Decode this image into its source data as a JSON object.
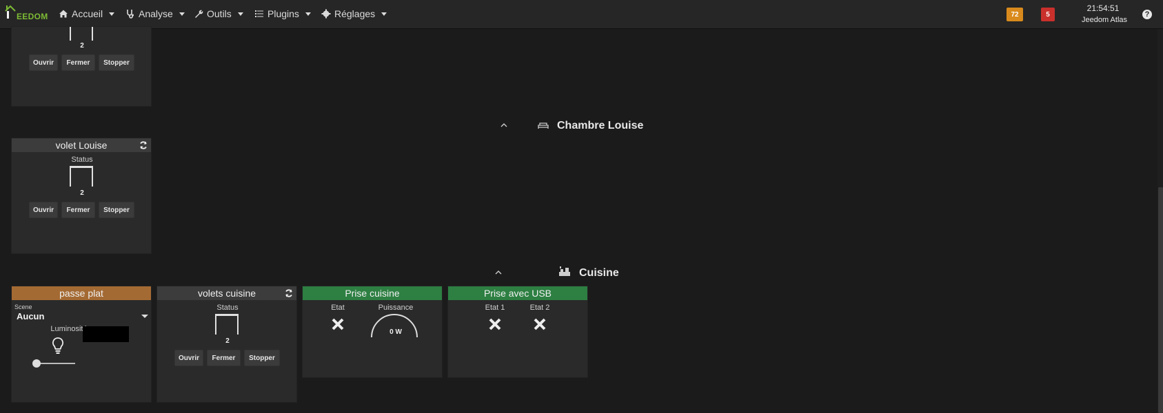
{
  "navbar": {
    "logo_text": "EEDOM",
    "menu": [
      {
        "label": "Accueil",
        "icon": "home-icon"
      },
      {
        "label": "Analyse",
        "icon": "stethoscope-icon"
      },
      {
        "label": "Outils",
        "icon": "wrench-icon"
      },
      {
        "label": "Plugins",
        "icon": "list-icon"
      },
      {
        "label": "Réglages",
        "icon": "gear-icon"
      }
    ],
    "badge_warning": "72",
    "badge_danger": "5",
    "clock": "21:54:51",
    "station": "Jeedom Atlas",
    "help": "?"
  },
  "widgets": {
    "top": {
      "value": "2",
      "buttons": [
        "Ouvrir",
        "Fermer",
        "Stopper"
      ]
    },
    "volet_louise": {
      "title": "volet Louise",
      "status_label": "Status",
      "value": "2",
      "buttons": [
        "Ouvrir",
        "Fermer",
        "Stopper"
      ]
    },
    "passe_plat": {
      "title": "passe plat",
      "scene_label": "Scene",
      "scene_value": "Aucun",
      "luminosite_label": "Luminosité"
    },
    "volets_cuisine": {
      "title": "volets cuisine",
      "status_label": "Status",
      "value": "2",
      "buttons": [
        "Ouvrir",
        "Fermer",
        "Stopper"
      ]
    },
    "prise_cuisine": {
      "title": "Prise cuisine",
      "etat_label": "Etat",
      "puissance_label": "Puissance",
      "puissance_value": "0 W"
    },
    "prise_usb": {
      "title": "Prise avec USB",
      "etat1_label": "Etat 1",
      "etat2_label": "Etat 2"
    }
  },
  "sections": {
    "chambre": {
      "title": "Chambre Louise",
      "icon": "bed-icon"
    },
    "cuisine": {
      "title": "Cuisine",
      "icon": "kitchen-icon"
    }
  },
  "colors": {
    "header_orange": "#a46a33",
    "header_green": "#2d7f42",
    "badge_warning": "#d98a1c",
    "badge_danger": "#c9302c"
  }
}
